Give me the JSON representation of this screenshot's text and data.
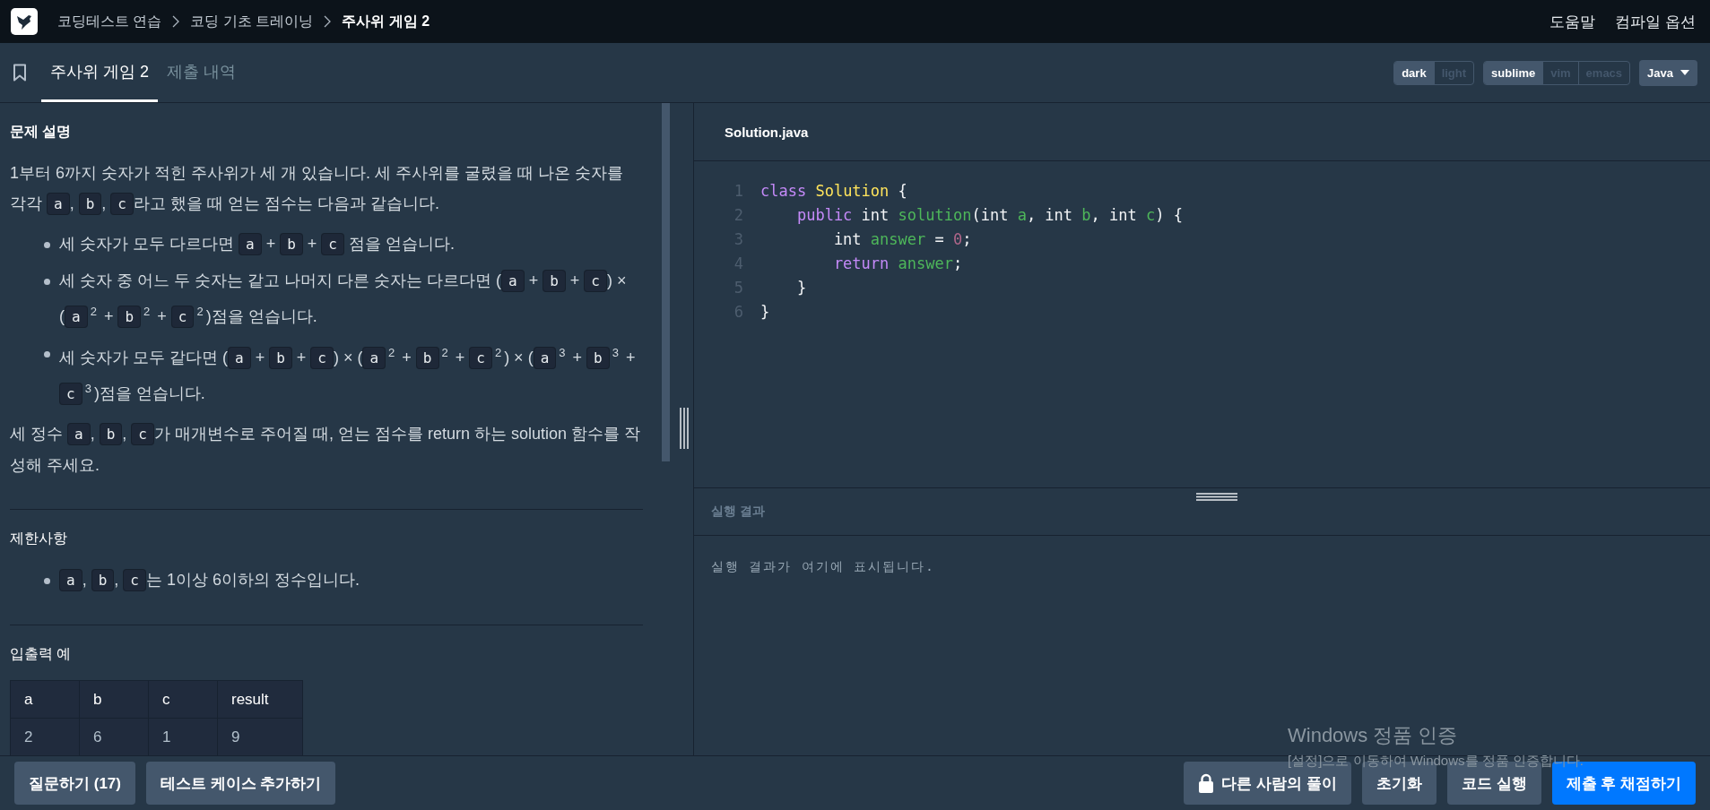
{
  "header": {
    "breadcrumbs": [
      {
        "label": "코딩테스트 연습",
        "selected": false
      },
      {
        "label": "코딩 기초 트레이닝",
        "selected": false
      },
      {
        "label": "주사위 게임 2",
        "selected": true
      }
    ],
    "links": [
      "도움말",
      "컴파일 옵션"
    ]
  },
  "tabs": [
    {
      "label": "주사위 게임 2",
      "selected": true
    },
    {
      "label": "제출 내역",
      "selected": false
    }
  ],
  "themes": [
    {
      "label": "dark",
      "selected": true
    },
    {
      "label": "light",
      "selected": false
    }
  ],
  "keymaps": [
    {
      "label": "sublime",
      "selected": true
    },
    {
      "label": "vim",
      "selected": false
    },
    {
      "label": "emacs",
      "selected": false
    }
  ],
  "language": "Java",
  "sections": [
    {
      "title": "문제 설명",
      "blocks": [
        {
          "kind": "paragraph",
          "segments": [
            {
              "kind": "text",
              "text": "1부터 6까지 숫자가 적힌 주사위가 세 개 있습니다. 세 주사위를 굴렸을 때 나온 숫자를 각각 "
            },
            {
              "kind": "code",
              "text": "a"
            },
            {
              "kind": "text",
              "text": ", "
            },
            {
              "kind": "code",
              "text": "b"
            },
            {
              "kind": "text",
              "text": ", "
            },
            {
              "kind": "code",
              "text": "c"
            },
            {
              "kind": "text",
              "text": "라고 했을 때 얻는 점수는 다음과 같습니다."
            }
          ]
        },
        {
          "kind": "list",
          "items": [
            [
              {
                "kind": "text",
                "text": "세 숫자가 모두 다르다면 "
              },
              {
                "kind": "code",
                "text": "a"
              },
              {
                "kind": "text",
                "text": " + "
              },
              {
                "kind": "code",
                "text": "b"
              },
              {
                "kind": "text",
                "text": " + "
              },
              {
                "kind": "code",
                "text": "c"
              },
              {
                "kind": "text",
                "text": " 점을 얻습니다."
              }
            ],
            [
              {
                "kind": "text",
                "text": "세 숫자 중 어느 두 숫자는 같고 나머지 다른 숫자는 다르다면 ("
              },
              {
                "kind": "code",
                "text": "a"
              },
              {
                "kind": "text",
                "text": " + "
              },
              {
                "kind": "code",
                "text": "b"
              },
              {
                "kind": "text",
                "text": " + "
              },
              {
                "kind": "code",
                "text": "c"
              },
              {
                "kind": "text",
                "text": ") × ("
              },
              {
                "kind": "code",
                "text": "a"
              },
              {
                "kind": "sup",
                "text": "2"
              },
              {
                "kind": "text",
                "text": " + "
              },
              {
                "kind": "code",
                "text": "b"
              },
              {
                "kind": "sup",
                "text": "2"
              },
              {
                "kind": "text",
                "text": " + "
              },
              {
                "kind": "code",
                "text": "c"
              },
              {
                "kind": "sup",
                "text": "2"
              },
              {
                "kind": "text",
                "text": ")점을 얻습니다."
              }
            ],
            [
              {
                "kind": "text",
                "text": "세 숫자가 모두 같다면 ("
              },
              {
                "kind": "code",
                "text": "a"
              },
              {
                "kind": "text",
                "text": " + "
              },
              {
                "kind": "code",
                "text": "b"
              },
              {
                "kind": "text",
                "text": " + "
              },
              {
                "kind": "code",
                "text": "c"
              },
              {
                "kind": "text",
                "text": ") × ("
              },
              {
                "kind": "code",
                "text": "a"
              },
              {
                "kind": "sup",
                "text": "2"
              },
              {
                "kind": "text",
                "text": " + "
              },
              {
                "kind": "code",
                "text": "b"
              },
              {
                "kind": "sup",
                "text": "2"
              },
              {
                "kind": "text",
                "text": " + "
              },
              {
                "kind": "code",
                "text": "c"
              },
              {
                "kind": "sup",
                "text": "2"
              },
              {
                "kind": "text",
                "text": ") × ("
              },
              {
                "kind": "code",
                "text": "a"
              },
              {
                "kind": "sup",
                "text": "3"
              },
              {
                "kind": "text",
                "text": " + "
              },
              {
                "kind": "code",
                "text": "b"
              },
              {
                "kind": "sup",
                "text": "3"
              },
              {
                "kind": "text",
                "text": " + "
              },
              {
                "kind": "code",
                "text": "c"
              },
              {
                "kind": "sup",
                "text": "3"
              },
              {
                "kind": "text",
                "text": ")점을 얻습니다."
              }
            ]
          ]
        },
        {
          "kind": "paragraph",
          "segments": [
            {
              "kind": "text",
              "text": "세 정수 "
            },
            {
              "kind": "code",
              "text": "a"
            },
            {
              "kind": "text",
              "text": ", "
            },
            {
              "kind": "code",
              "text": "b"
            },
            {
              "kind": "text",
              "text": ", "
            },
            {
              "kind": "code",
              "text": "c"
            },
            {
              "kind": "text",
              "text": "가 매개변수로 주어질 때, 얻는 점수를 return 하는 solution 함수를 작성해 주세요."
            }
          ]
        }
      ]
    },
    {
      "title": "제한사항",
      "blocks": [
        {
          "kind": "list",
          "items": [
            [
              {
                "kind": "code",
                "text": "a"
              },
              {
                "kind": "text",
                "text": ", "
              },
              {
                "kind": "code",
                "text": "b"
              },
              {
                "kind": "text",
                "text": ", "
              },
              {
                "kind": "code",
                "text": "c"
              },
              {
                "kind": "text",
                "text": "는 1이상 6이하의 정수입니다."
              }
            ]
          ]
        }
      ]
    },
    {
      "title": "입출력 예",
      "blocks": [
        {
          "kind": "table",
          "columns": [
            "a",
            "b",
            "c",
            "result"
          ],
          "rows": [
            [
              "2",
              "6",
              "1",
              "9"
            ]
          ]
        }
      ]
    }
  ],
  "editor": {
    "file": "Solution.java",
    "lines": [
      [
        {
          "kind": "keyword",
          "text": "class"
        },
        {
          "kind": "class",
          "text": " Solution"
        },
        {
          "kind": "plain",
          "text": " {"
        }
      ],
      [
        {
          "kind": "keyword",
          "text": "    public"
        },
        {
          "kind": "plain",
          "text": " int "
        },
        {
          "kind": "name",
          "text": "solution"
        },
        {
          "kind": "plain",
          "text": "(int "
        },
        {
          "kind": "name",
          "text": "a"
        },
        {
          "kind": "plain",
          "text": ", int "
        },
        {
          "kind": "name",
          "text": "b"
        },
        {
          "kind": "plain",
          "text": ", int "
        },
        {
          "kind": "name",
          "text": "c"
        },
        {
          "kind": "plain",
          "text": ") {"
        }
      ],
      [
        {
          "kind": "plain",
          "text": "        int "
        },
        {
          "kind": "name",
          "text": "answer"
        },
        {
          "kind": "plain",
          "text": " = "
        },
        {
          "kind": "number",
          "text": "0"
        },
        {
          "kind": "plain",
          "text": ";"
        }
      ],
      [
        {
          "kind": "keyword",
          "text": "        return"
        },
        {
          "kind": "name",
          "text": " answer"
        },
        {
          "kind": "plain",
          "text": ";"
        }
      ],
      [
        {
          "kind": "plain",
          "text": "    }"
        }
      ],
      [
        {
          "kind": "plain",
          "text": "}"
        }
      ]
    ],
    "line_numbers": [
      "1",
      "2",
      "3",
      "4",
      "5",
      "6"
    ]
  },
  "result": {
    "title": "실행 결과",
    "placeholder": "실행 결과가 여기에 표시됩니다."
  },
  "footer": {
    "left_buttons": [
      "질문하기 (17)",
      "테스트 케이스 추가하기"
    ],
    "right_buttons": [
      {
        "label": "다른 사람의 풀이",
        "kind": "locked"
      },
      {
        "label": "초기화",
        "kind": "plain"
      },
      {
        "label": "코드 실행",
        "kind": "plain"
      },
      {
        "label": "제출 후 채점하기",
        "kind": "primary"
      }
    ]
  },
  "os_notice": {
    "title": "Windows 정품 인증",
    "message": "[설정]으로 이동하여 Windows를 정품 인증합니다."
  }
}
